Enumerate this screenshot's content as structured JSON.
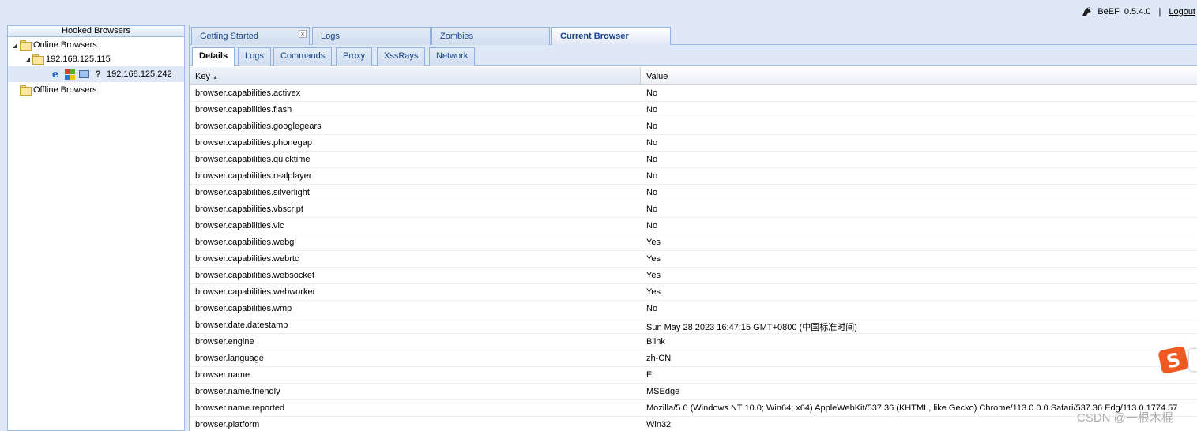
{
  "header": {
    "app_name": "BeEF",
    "version": "0.5.4.0",
    "separator": "|",
    "logout_label": "Logout"
  },
  "left_panel": {
    "title": "Hooked Browsers",
    "online": "Online Browsers",
    "subnet": "192.168.125.115",
    "browser_ip": "192.168.125.242",
    "offline": "Offline Browsers",
    "icons": [
      "ie-icon",
      "windows-icon",
      "pc-icon",
      "unknown-icon"
    ]
  },
  "main_tabs": [
    {
      "label": "Getting Started"
    },
    {
      "label": "Logs"
    },
    {
      "label": "Zombies"
    },
    {
      "label": "Current Browser"
    }
  ],
  "sub_tabs": [
    {
      "label": "Details"
    },
    {
      "label": "Logs"
    },
    {
      "label": "Commands"
    },
    {
      "label": "Proxy"
    },
    {
      "label": "XssRays"
    },
    {
      "label": "Network"
    }
  ],
  "grid": {
    "columns": [
      "Key",
      "Value"
    ],
    "rows": [
      [
        "browser.capabilities.activex",
        "No"
      ],
      [
        "browser.capabilities.flash",
        "No"
      ],
      [
        "browser.capabilities.googlegears",
        "No"
      ],
      [
        "browser.capabilities.phonegap",
        "No"
      ],
      [
        "browser.capabilities.quicktime",
        "No"
      ],
      [
        "browser.capabilities.realplayer",
        "No"
      ],
      [
        "browser.capabilities.silverlight",
        "No"
      ],
      [
        "browser.capabilities.vbscript",
        "No"
      ],
      [
        "browser.capabilities.vlc",
        "No"
      ],
      [
        "browser.capabilities.webgl",
        "Yes"
      ],
      [
        "browser.capabilities.webrtc",
        "Yes"
      ],
      [
        "browser.capabilities.websocket",
        "Yes"
      ],
      [
        "browser.capabilities.webworker",
        "Yes"
      ],
      [
        "browser.capabilities.wmp",
        "No"
      ],
      [
        "browser.date.datestamp",
        "Sun May 28 2023 16:47:15 GMT+0800 (中国标准时间)"
      ],
      [
        "browser.engine",
        "Blink"
      ],
      [
        "browser.language",
        "zh-CN"
      ],
      [
        "browser.name",
        "E"
      ],
      [
        "browser.name.friendly",
        "MSEdge"
      ],
      [
        "browser.name.reported",
        "Mozilla/5.0 (Windows NT 10.0; Win64; x64) AppleWebKit/537.36 (KHTML, like Gecko) Chrome/113.0.0.0 Safari/537.36 Edg/113.0.1774.57"
      ],
      [
        "browser.platform",
        "Win32"
      ]
    ]
  },
  "watermark": "CSDN @一根木棍"
}
